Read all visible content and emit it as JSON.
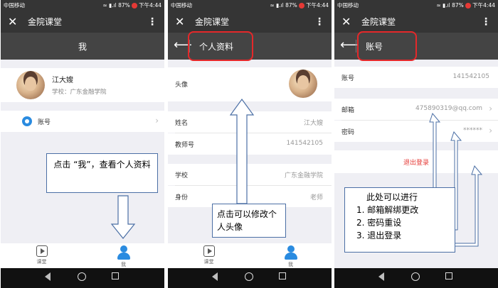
{
  "status_bar": {
    "carrier": "中国移动",
    "battery": "87%",
    "time": "下午4:44",
    "icons": "≈ ▮.ıl"
  },
  "app": {
    "title": "金院课堂",
    "close_glyph": "✕",
    "more_glyph": "⋮",
    "back_glyph": "⟵"
  },
  "screen1": {
    "header": "我",
    "name": "江大嫂",
    "school_line": "学校：广东金融学院",
    "account_label": "账号",
    "chevron": "›",
    "callout": "点击 “我”，查看个人资料"
  },
  "screen2": {
    "header": "个人资料",
    "avatar_label": "头像",
    "rows": [
      {
        "key": "姓名",
        "value": "江大嫂"
      },
      {
        "key": "教师号",
        "value": "141542105"
      },
      {
        "key": "学校",
        "value": "广东金融学院"
      },
      {
        "key": "身份",
        "value": "老师"
      }
    ],
    "callout": "点击可以修改个人头像"
  },
  "screen3": {
    "header": "账号",
    "account_row": {
      "key": "账号",
      "value": "141542105"
    },
    "email_row": {
      "key": "邮箱",
      "value": "475890319@qq.com"
    },
    "password_row": {
      "key": "密码",
      "value": "******"
    },
    "logout": "退出登录",
    "callout": {
      "title": "此处可以进行",
      "items": [
        "1.  邮箱解绑更改",
        "2.  密码重设",
        "3.  退出登录"
      ]
    }
  },
  "tabs": {
    "course": "课堂",
    "me": "我"
  },
  "colors": {
    "accent": "#2a8be0",
    "highlight": "#e5282a",
    "callout_border": "#4b6fa5",
    "bar": "#353535"
  },
  "icons": {
    "course_tab": "play-box-icon",
    "me_tab": "person-icon",
    "settings": "gear-icon"
  }
}
